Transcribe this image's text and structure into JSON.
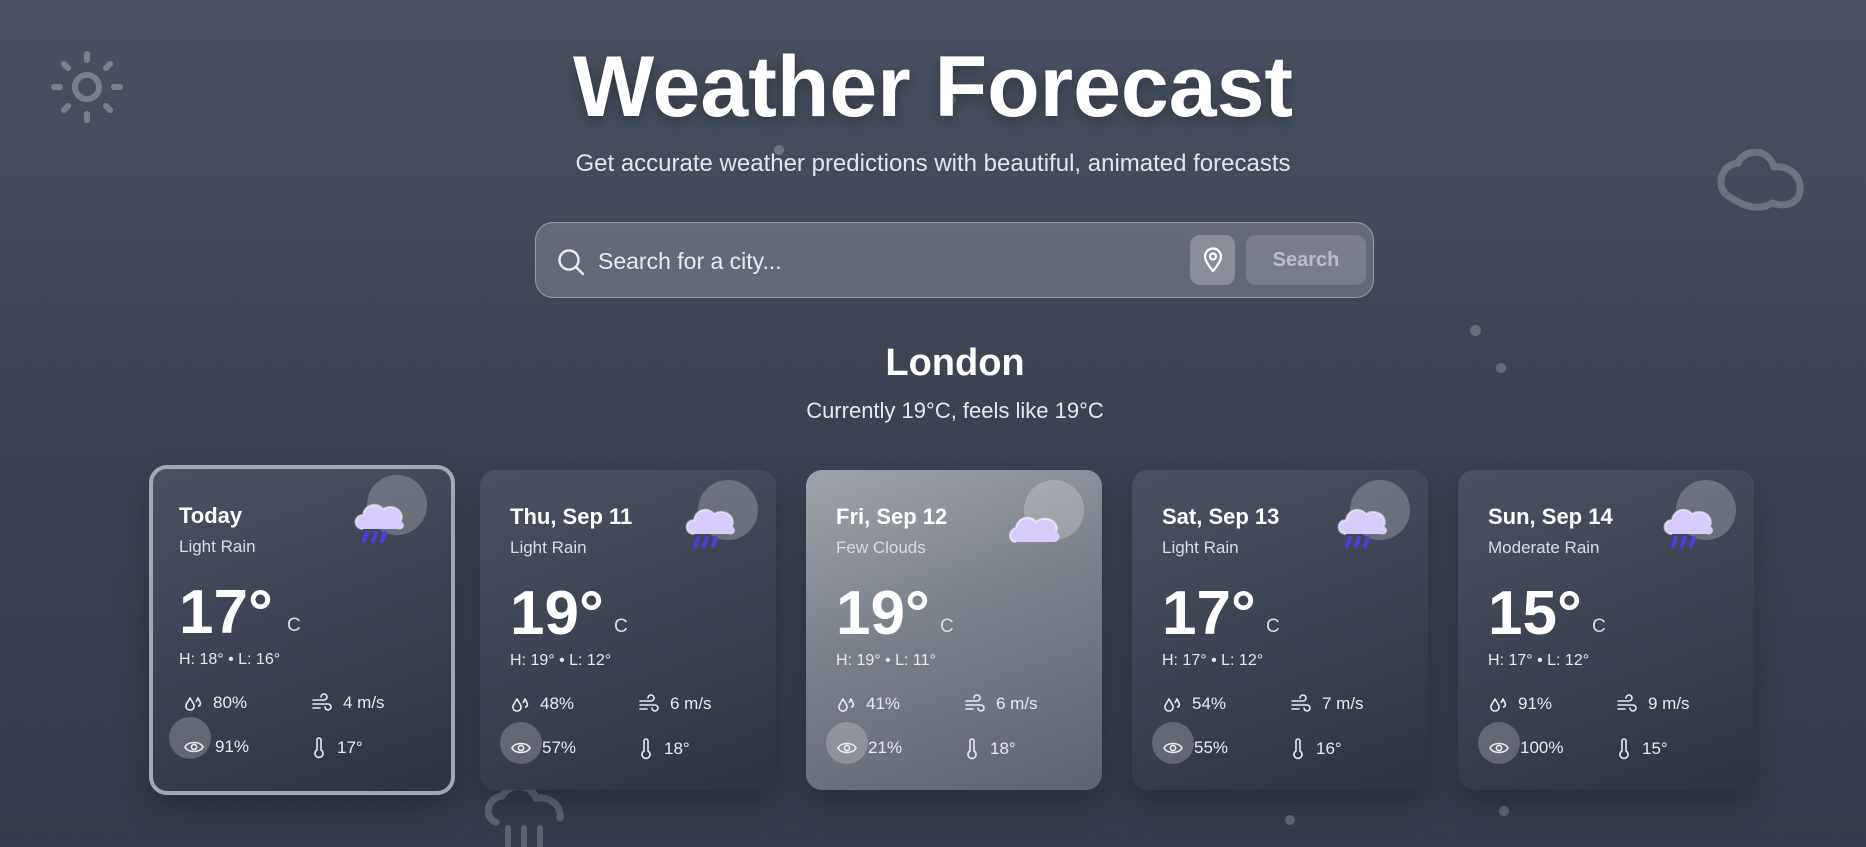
{
  "header": {
    "title": "Weather Forecast",
    "subtitle": "Get accurate weather predictions with beautiful, animated forecasts"
  },
  "search": {
    "placeholder": "Search for a city...",
    "button_label": "Search"
  },
  "location": {
    "city": "London",
    "current": "Currently 19°C, feels like 19°C"
  },
  "forecast": [
    {
      "day": "Today",
      "condition": "Light Rain",
      "icon": "rain-cloud-icon",
      "temp": "17°",
      "unit": "C",
      "hl": "H: 18°  •  L: 16°",
      "humidity": "80%",
      "wind": "4 m/s",
      "visibility": "91%",
      "feels": "17°",
      "selected": true
    },
    {
      "day": "Thu, Sep 11",
      "condition": "Light Rain",
      "icon": "rain-cloud-icon",
      "temp": "19°",
      "unit": "C",
      "hl": "H: 19°  •  L: 12°",
      "humidity": "48%",
      "wind": "6 m/s",
      "visibility": "57%",
      "feels": "18°"
    },
    {
      "day": "Fri, Sep 12",
      "condition": "Few Clouds",
      "icon": "cloud-icon",
      "temp": "19°",
      "unit": "C",
      "hl": "H: 19°  •  L: 11°",
      "humidity": "41%",
      "wind": "6 m/s",
      "visibility": "21%",
      "feels": "18°"
    },
    {
      "day": "Sat, Sep 13",
      "condition": "Light Rain",
      "icon": "rain-cloud-icon",
      "temp": "17°",
      "unit": "C",
      "hl": "H: 17°  •  L: 12°",
      "humidity": "54%",
      "wind": "7 m/s",
      "visibility": "55%",
      "feels": "16°"
    },
    {
      "day": "Sun, Sep 14",
      "condition": "Moderate Rain",
      "icon": "rain-cloud-icon",
      "temp": "15°",
      "unit": "C",
      "hl": "H: 17°  •  L: 12°",
      "humidity": "91%",
      "wind": "9 m/s",
      "visibility": "100%",
      "feels": "15°"
    }
  ],
  "colors": {
    "cloud": "#d8ccff",
    "rain": "#4a3fe0"
  }
}
